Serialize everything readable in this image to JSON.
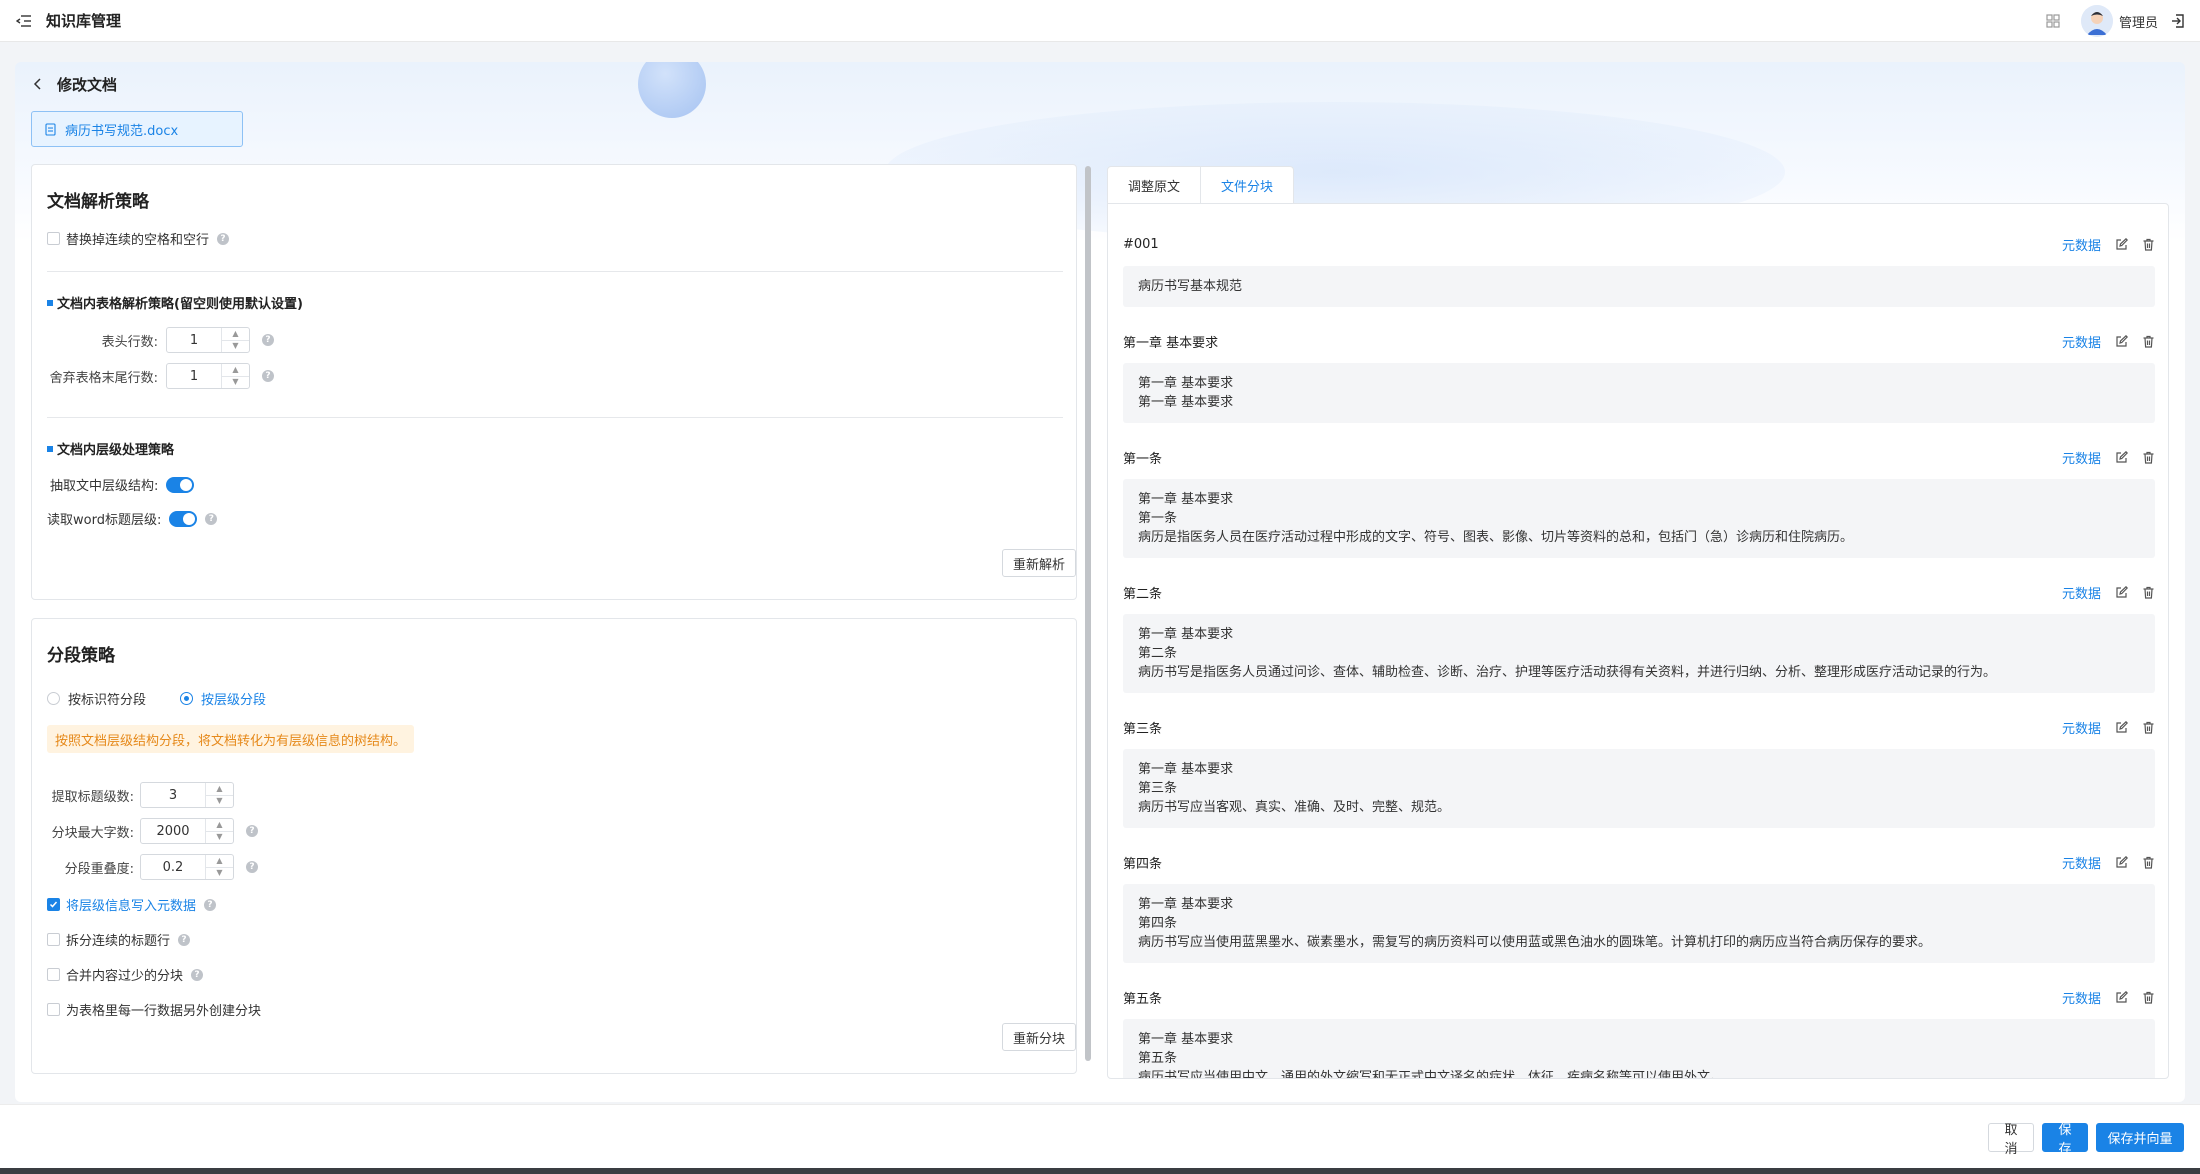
{
  "header": {
    "app_title": "知识库管理",
    "user_name": "管理员"
  },
  "page": {
    "title": "修改文档",
    "file_name": "病历书写规范.docx"
  },
  "parse_panel": {
    "title": "文档解析策略",
    "replace_spaces_label": "替换掉连续的空格和空行",
    "table_section": "文档内表格解析策略(留空则使用默认设置)",
    "header_rows_label": "表头行数:",
    "header_rows_value": "1",
    "discard_tail_label": "舍弃表格末尾行数:",
    "discard_tail_value": "1",
    "level_section": "文档内层级处理策略",
    "extract_levels_label": "抽取文中层级结构:",
    "word_title_label": "读取word标题层级:",
    "reparse_button": "重新解析"
  },
  "split_panel": {
    "title": "分段策略",
    "radio_identifier": "按标识符分段",
    "radio_level": "按层级分段",
    "notice": "按照文档层级结构分段，将文档转化为有层级信息的树结构。",
    "title_levels_label": "提取标题级数:",
    "title_levels_value": "3",
    "max_chars_label": "分块最大字数:",
    "max_chars_value": "2000",
    "overlap_label": "分段重叠度:",
    "overlap_value": "0.2",
    "write_meta_label": "将层级信息写入元数据",
    "split_titles_label": "拆分连续的标题行",
    "merge_small_label": "合并内容过少的分块",
    "table_row_label": "为表格里每一行数据另外创建分块",
    "resplit_button": "重新分块"
  },
  "tabs": [
    {
      "label": "调整原文"
    },
    {
      "label": "文件分块"
    }
  ],
  "chunks": [
    {
      "title": "#001",
      "meta": "元数据",
      "lines": [
        "病历书写基本规范"
      ]
    },
    {
      "title": "第一章  基本要求",
      "meta": "元数据",
      "lines": [
        "第一章  基本要求",
        "第一章 基本要求"
      ]
    },
    {
      "title": "第一条",
      "meta": "元数据",
      "lines": [
        "第一章  基本要求",
        "第一条",
        "病历是指医务人员在医疗活动过程中形成的文字、符号、图表、影像、切片等资料的总和，包括门（急）诊病历和住院病历。"
      ]
    },
    {
      "title": "第二条",
      "meta": "元数据",
      "lines": [
        "第一章  基本要求",
        "第二条",
        "病历书写是指医务人员通过问诊、查体、辅助检查、诊断、治疗、护理等医疗活动获得有关资料，并进行归纳、分析、整理形成医疗活动记录的行为。"
      ]
    },
    {
      "title": "第三条",
      "meta": "元数据",
      "lines": [
        "第一章  基本要求",
        "第三条",
        "病历书写应当客观、真实、准确、及时、完整、规范。"
      ]
    },
    {
      "title": "第四条",
      "meta": "元数据",
      "lines": [
        "第一章  基本要求",
        "第四条",
        "病历书写应当使用蓝黑墨水、碳素墨水，需复写的病历资料可以使用蓝或黑色油水的圆珠笔。计算机打印的病历应当符合病历保存的要求。"
      ]
    },
    {
      "title": "第五条",
      "meta": "元数据",
      "lines": [
        "第一章  基本要求",
        "第五条",
        "病历书写应当使用中文，通用的外文缩写和无正式中文译名的症状、体征、疾病名称等可以使用外文。"
      ]
    }
  ],
  "footer": {
    "cancel": "取消",
    "save": "保存",
    "save_vector": "保存并向量"
  },
  "colors": {
    "accent": "#1a83e6",
    "notice_bg": "#fff3e0",
    "notice_text": "#e6891a"
  }
}
